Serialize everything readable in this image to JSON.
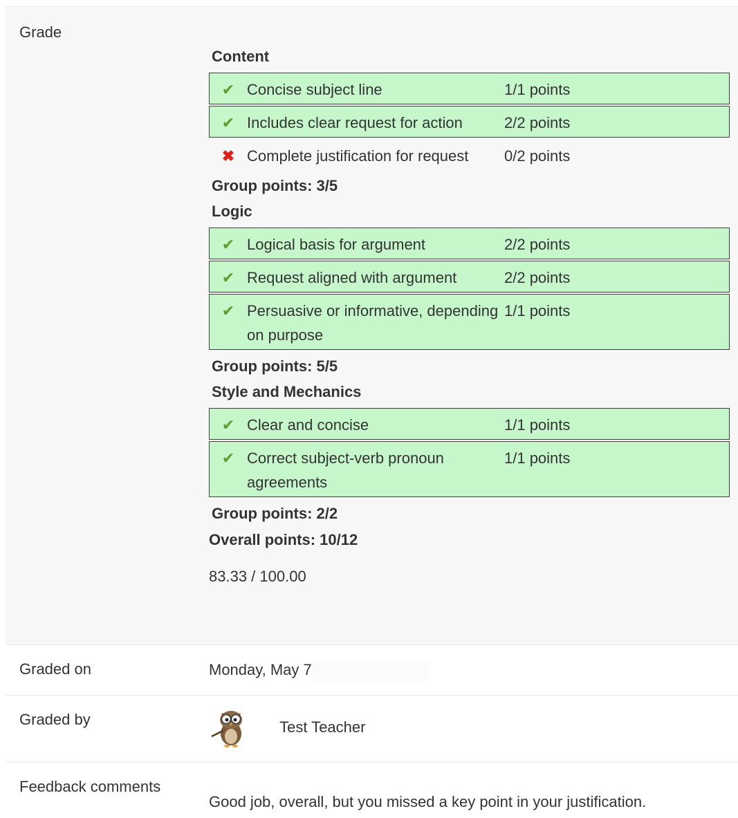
{
  "grade": {
    "label": "Grade",
    "groups": [
      {
        "title": "Content",
        "criteria": [
          {
            "desc": "Concise subject line",
            "points": "1/1 points",
            "met": true
          },
          {
            "desc": "Includes clear request for action",
            "points": "2/2 points",
            "met": true
          },
          {
            "desc": "Complete justification for request",
            "points": "0/2 points",
            "met": false
          }
        ],
        "group_points": "Group points: 3/5"
      },
      {
        "title": "Logic",
        "criteria": [
          {
            "desc": "Logical basis for argument",
            "points": "2/2 points",
            "met": true
          },
          {
            "desc": "Request aligned with argument",
            "points": "2/2 points",
            "met": true
          },
          {
            "desc": "Persuasive or informative, depending on purpose",
            "points": "1/1 points",
            "met": true
          }
        ],
        "group_points": "Group points: 5/5"
      },
      {
        "title": "Style and Mechanics",
        "criteria": [
          {
            "desc": "Clear and concise",
            "points": "1/1 points",
            "met": true
          },
          {
            "desc": "Correct subject-verb pronoun agreements",
            "points": "1/1 points",
            "met": true
          }
        ],
        "group_points": "Group points: 2/2"
      }
    ],
    "overall": "Overall points: 10/12",
    "final": "83.33 / 100.00"
  },
  "graded_on": {
    "label": "Graded on",
    "value": "Monday, May 7"
  },
  "graded_by": {
    "label": "Graded by",
    "name": "Test Teacher",
    "avatar_icon": "owl-teacher-avatar"
  },
  "feedback": {
    "label": "Feedback comments",
    "text": "Good job, overall, but you missed a key point in your justification."
  },
  "colors": {
    "pass_bg": "#c6f7cb",
    "check": "#5aa02c",
    "cross": "#e0201a",
    "grade_bg": "#f7f7f7"
  }
}
